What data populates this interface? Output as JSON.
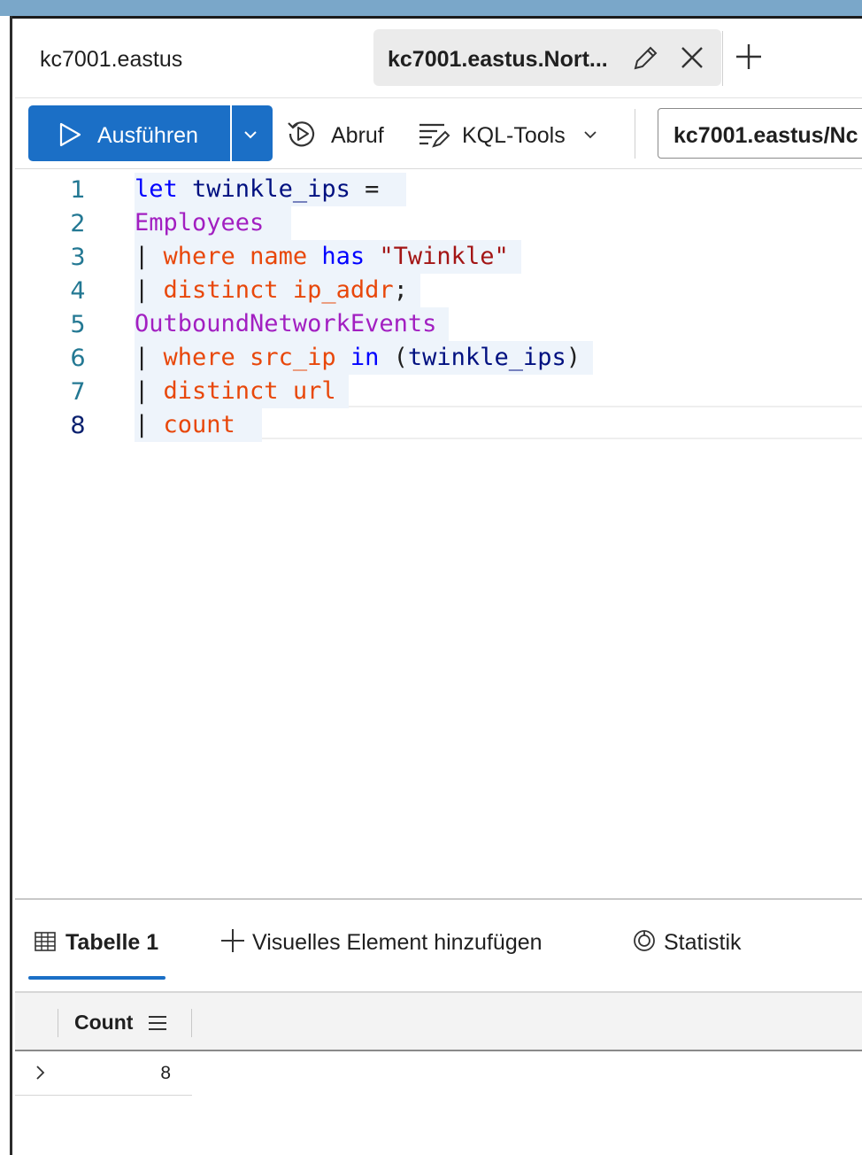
{
  "tabs": [
    {
      "label": "kc7001.eastus",
      "active": false
    },
    {
      "label": "kc7001.eastus.Nort...",
      "active": true
    }
  ],
  "icons": {
    "edit": "pencil-icon",
    "close": "close-icon",
    "add": "plus-icon",
    "run": "play-icon",
    "dropdown": "chevron-down-icon",
    "recall": "recall-icon",
    "kql_tools": "kql-tools-icon",
    "table": "table-icon",
    "add_visual": "plus-icon",
    "stats": "stats-icon",
    "column_menu": "hamburger-menu-icon",
    "expand_row": "chevron-right-icon"
  },
  "toolbar": {
    "run_label": "Ausführen",
    "recall_label": "Abruf",
    "kql_tools_label": "KQL-Tools",
    "database_selector": "kc7001.eastus/Nc"
  },
  "editor": {
    "lines": [
      {
        "num": "1",
        "tokens": [
          {
            "t": "let",
            "c": "kw"
          },
          {
            "t": " twinkle_ips ",
            "c": "dk"
          },
          {
            "t": "=",
            "c": "id"
          },
          {
            "t": " ",
            "c": "id"
          }
        ]
      },
      {
        "num": "2",
        "tokens": [
          {
            "t": "Employees",
            "c": "tbl"
          },
          {
            "t": " ",
            "c": "id"
          }
        ]
      },
      {
        "num": "3",
        "tokens": [
          {
            "t": "| ",
            "c": "id"
          },
          {
            "t": "where",
            "c": "op"
          },
          {
            "t": " ",
            "c": "id"
          },
          {
            "t": "name",
            "c": "op"
          },
          {
            "t": " ",
            "c": "id"
          },
          {
            "t": "has",
            "c": "kw"
          },
          {
            "t": " ",
            "c": "id"
          },
          {
            "t": "\"Twinkle\"",
            "c": "str"
          }
        ]
      },
      {
        "num": "4",
        "tokens": [
          {
            "t": "| ",
            "c": "id"
          },
          {
            "t": "distinct",
            "c": "op"
          },
          {
            "t": " ",
            "c": "id"
          },
          {
            "t": "ip_addr",
            "c": "op"
          },
          {
            "t": ";",
            "c": "id"
          }
        ]
      },
      {
        "num": "5",
        "tokens": [
          {
            "t": "OutboundNetworkEvents",
            "c": "tbl"
          }
        ]
      },
      {
        "num": "6",
        "tokens": [
          {
            "t": "| ",
            "c": "id"
          },
          {
            "t": "where",
            "c": "op"
          },
          {
            "t": " ",
            "c": "id"
          },
          {
            "t": "src_ip",
            "c": "op"
          },
          {
            "t": " ",
            "c": "id"
          },
          {
            "t": "in",
            "c": "kw"
          },
          {
            "t": " (",
            "c": "id"
          },
          {
            "t": "twinkle_ips",
            "c": "dk"
          },
          {
            "t": ")",
            "c": "id"
          }
        ]
      },
      {
        "num": "7",
        "tokens": [
          {
            "t": "| ",
            "c": "id"
          },
          {
            "t": "distinct",
            "c": "op"
          },
          {
            "t": " ",
            "c": "id"
          },
          {
            "t": "url",
            "c": "op"
          }
        ]
      },
      {
        "num": "8",
        "tokens": [
          {
            "t": "| ",
            "c": "id"
          },
          {
            "t": "count",
            "c": "op"
          },
          {
            "t": " ",
            "c": "id"
          }
        ]
      }
    ],
    "active_line": "8"
  },
  "results": {
    "tabs": {
      "table": "Tabelle 1",
      "add_visual": "Visuelles Element hinzufügen",
      "stats": "Statistik"
    },
    "columns": [
      "Count"
    ],
    "rows": [
      [
        "8"
      ]
    ]
  },
  "colors": {
    "accent": "#1b6fc6",
    "keyword": "#0000ff",
    "table_name": "#a21fc1",
    "operator": "#e8470a",
    "string": "#a31515",
    "line_number": "#237893"
  }
}
